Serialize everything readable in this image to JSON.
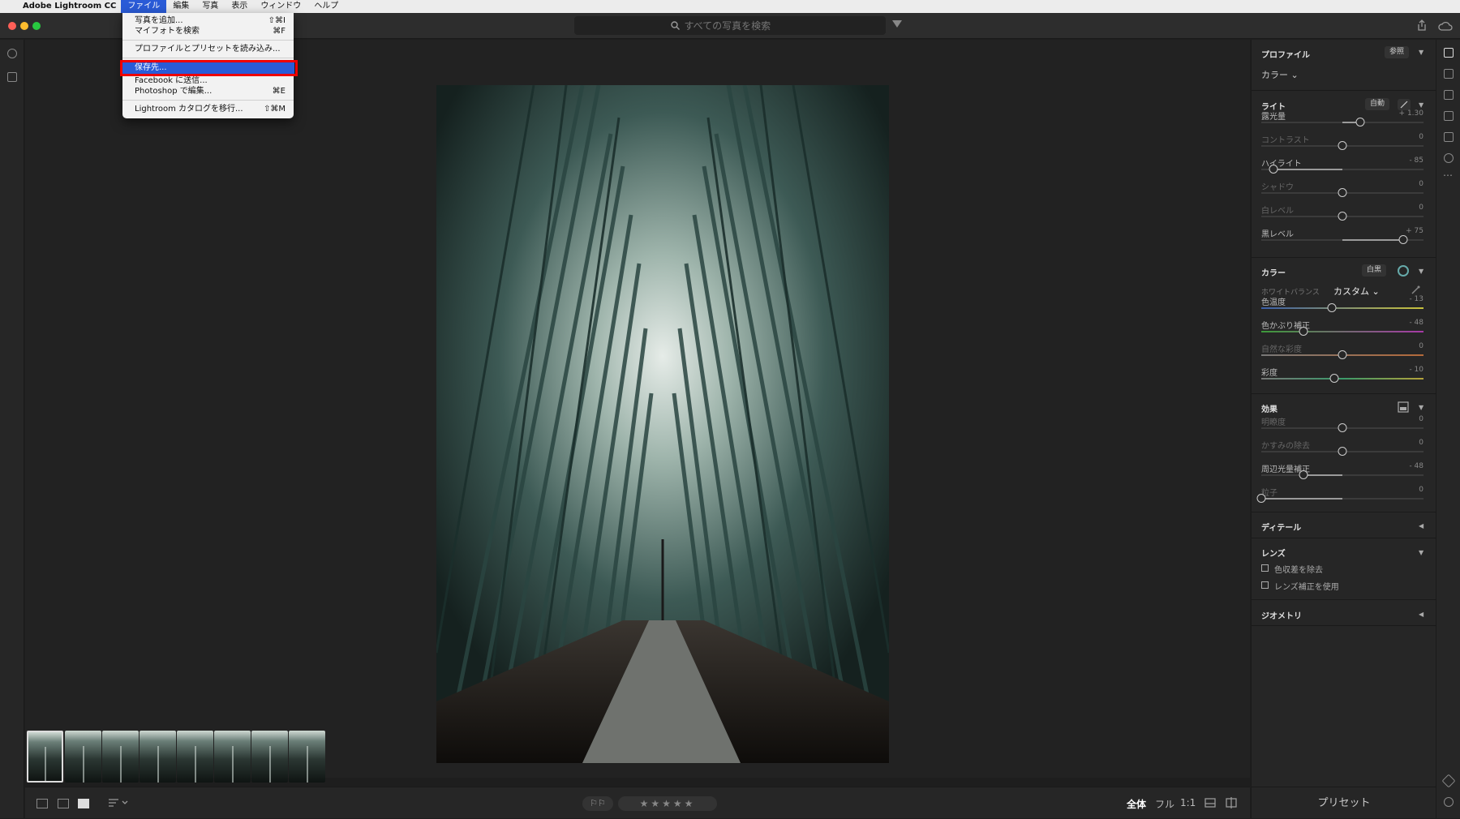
{
  "menubar": {
    "apple": "",
    "app_name": "Adobe Lightroom CC",
    "menus": [
      "ファイル",
      "編集",
      "写真",
      "表示",
      "ウィンドウ",
      "ヘルプ"
    ]
  },
  "titlebar": {
    "search_placeholder": "すべての写真を検索"
  },
  "file_menu": {
    "items": [
      {
        "label": "写真を追加...",
        "shortcut": "⇧⌘I"
      },
      {
        "label": "マイフォトを検索",
        "shortcut": "⌘F"
      },
      {
        "label": "プロファイルとプリセットを読み込み...",
        "shortcut": ""
      },
      {
        "label": "保存先...",
        "shortcut": ""
      },
      {
        "label": "Facebook に送信...",
        "shortcut": ""
      },
      {
        "label": "Photoshop で編集...",
        "shortcut": "⌘E"
      },
      {
        "label": "Lightroom カタログを移行...",
        "shortcut": "⇧⌘M"
      }
    ]
  },
  "right_panel": {
    "profile": {
      "title": "プロファイル",
      "browse_btn": "参照",
      "value": "カラー ⌄"
    },
    "light": {
      "title": "ライト",
      "auto_btn": "自動",
      "sliders": [
        {
          "label": "露光量",
          "value": "+ 1.30",
          "pos": 0.61
        },
        {
          "label": "コントラスト",
          "value": "0",
          "pos": 0.5
        },
        {
          "label": "ハイライト",
          "value": "- 85",
          "pos": 0.075
        },
        {
          "label": "シャドウ",
          "value": "0",
          "pos": 0.5
        },
        {
          "label": "白レベル",
          "value": "0",
          "pos": 0.5
        },
        {
          "label": "黒レベル",
          "value": "+ 75",
          "pos": 0.875
        }
      ]
    },
    "color": {
      "title": "カラー",
      "bw_btn": "白黒",
      "wb_label": "ホワイトバランス",
      "wb_value": "カスタム ⌄",
      "sliders": [
        {
          "label": "色温度",
          "value": "- 13",
          "pos": 0.435
        },
        {
          "label": "色かぶり補正",
          "value": "- 48",
          "pos": 0.26
        },
        {
          "label": "自然な彩度",
          "value": "0",
          "pos": 0.5
        },
        {
          "label": "彩度",
          "value": "- 10",
          "pos": 0.45
        }
      ]
    },
    "effects": {
      "title": "効果",
      "sliders": [
        {
          "label": "明瞭度",
          "value": "0",
          "pos": 0.5
        },
        {
          "label": "かすみの除去",
          "value": "0",
          "pos": 0.5
        },
        {
          "label": "周辺光量補正",
          "value": "- 48",
          "pos": 0.26
        },
        {
          "label": "粒子",
          "value": "0",
          "pos": 0.0
        }
      ]
    },
    "detail": {
      "title": "ディテール"
    },
    "lens": {
      "title": "レンズ",
      "options": [
        "色収差を除去",
        "レンズ補正を使用"
      ]
    },
    "geometry": {
      "title": "ジオメトリ"
    },
    "presets_btn": "プリセット"
  },
  "bottombar": {
    "flags": "⚐⚐",
    "stars": "★★★★★",
    "zoom": [
      "全体",
      "フル",
      "1:1"
    ]
  },
  "colors": {
    "accent": "#2a5bd7",
    "highlight_box": "#e00000"
  }
}
